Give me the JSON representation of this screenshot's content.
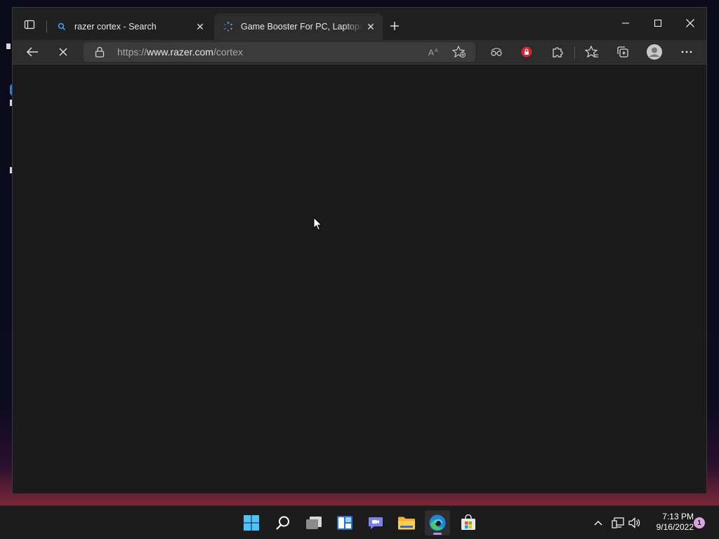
{
  "browser": {
    "tabs": [
      {
        "title": "razer cortex - Search",
        "active": false,
        "icon": "search-icon"
      },
      {
        "title": "Game Booster For PC, Laptops | Razer Cortex",
        "active": true,
        "icon": "loading-icon"
      }
    ],
    "address": {
      "scheme": "https://",
      "host": "www.razer.com",
      "path": "/cortex"
    },
    "loading": true
  },
  "taskbar": {
    "apps": [
      "windows-start",
      "search",
      "task-view",
      "widgets",
      "teams-chat",
      "file-explorer",
      "microsoft-edge",
      "microsoft-store"
    ],
    "active_app": "microsoft-edge",
    "clock": {
      "time": "7:13 PM",
      "date": "9/16/2022"
    },
    "notification_count": "1"
  },
  "colors": {
    "accent": "#c58bd1",
    "window_bg": "#202020",
    "toolbar_bg": "#2d2d2d",
    "content_bg": "#1b1b1b"
  }
}
